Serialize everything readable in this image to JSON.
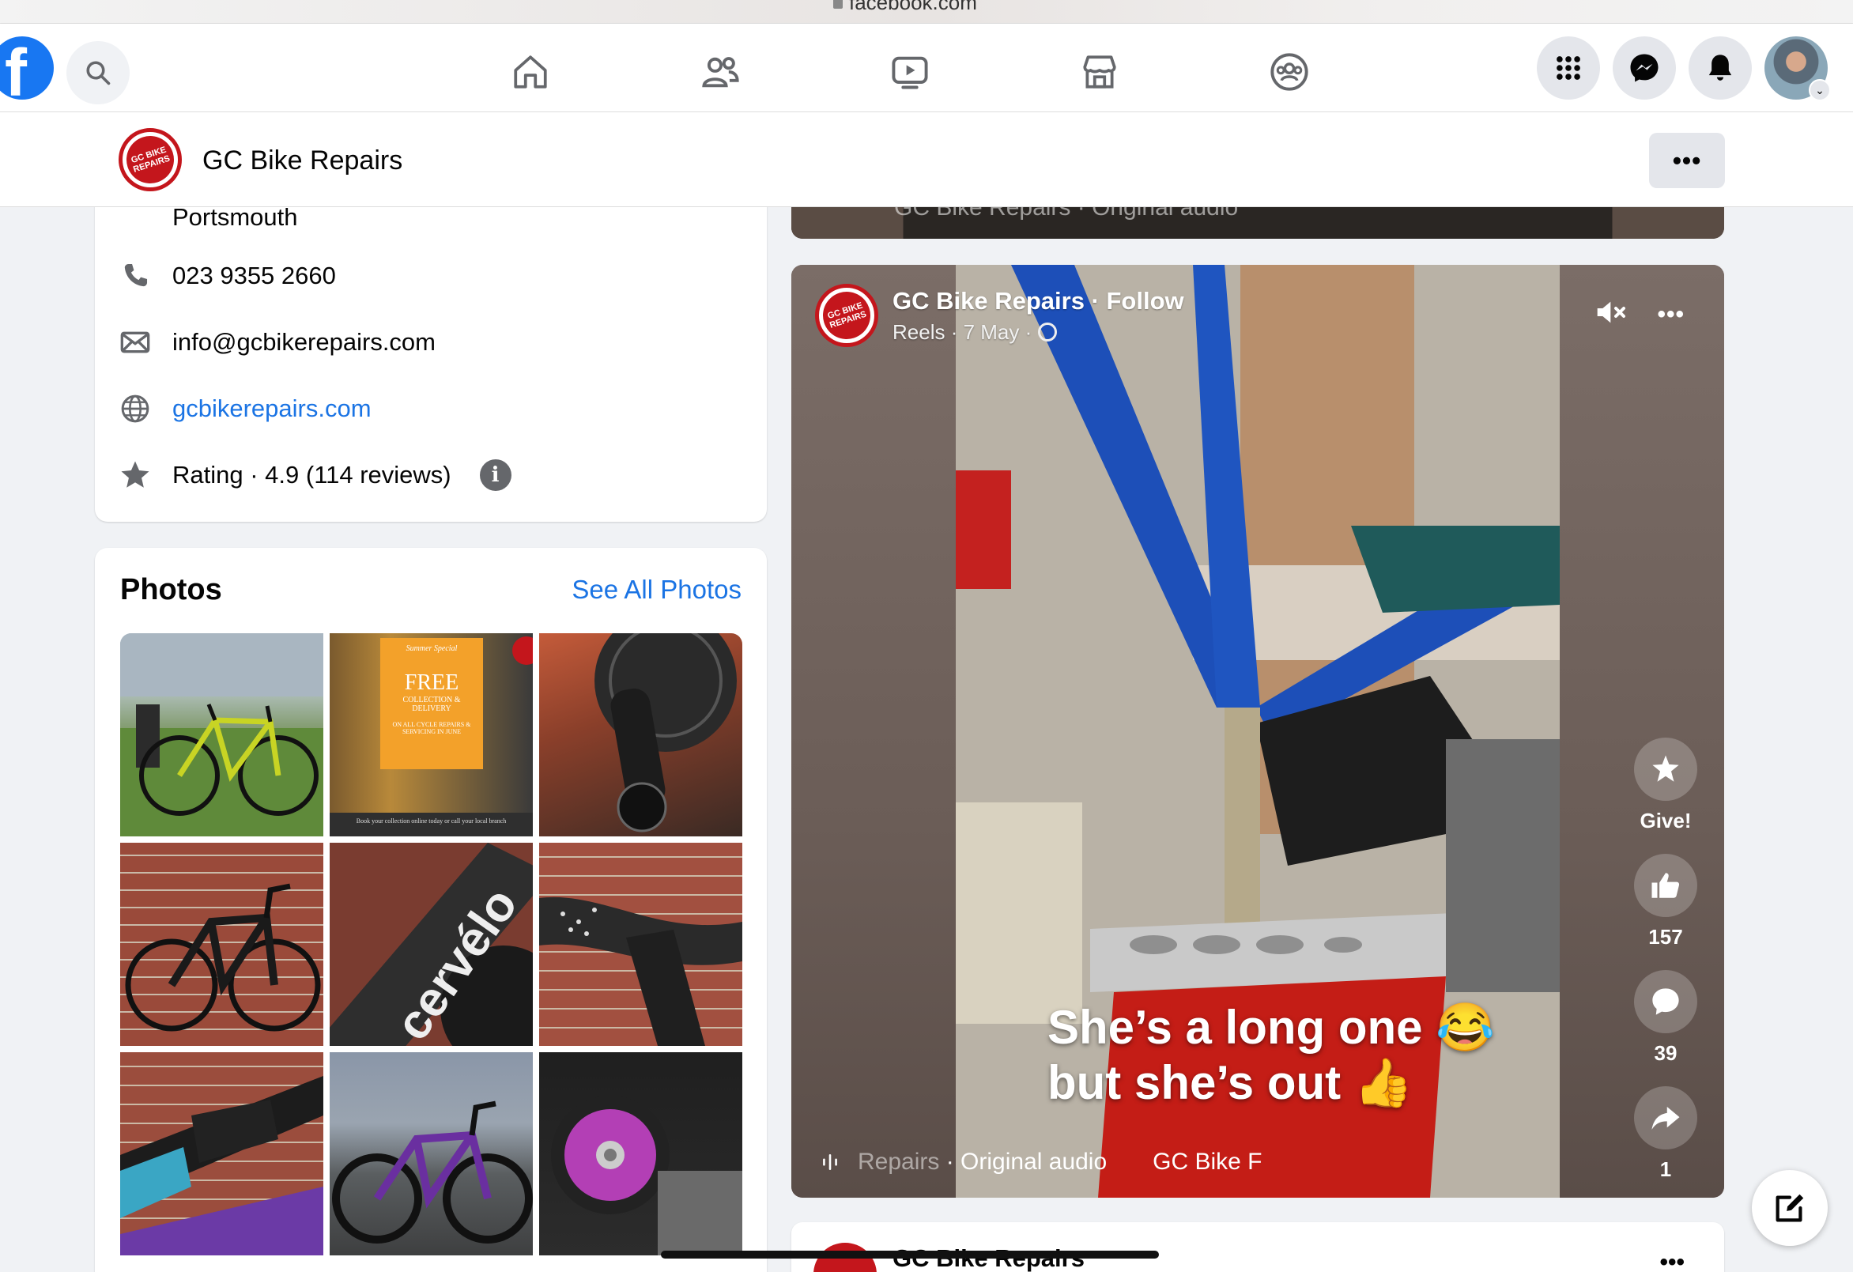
{
  "browser": {
    "url": "facebook.com"
  },
  "topnav": {
    "logo": "f",
    "icons": [
      "search-icon",
      "home-icon",
      "friends-icon",
      "watch-icon",
      "marketplace-icon",
      "groups-icon",
      "menu-grid-icon",
      "messenger-icon",
      "notifications-icon"
    ]
  },
  "page_header": {
    "name": "GC Bike Repairs",
    "logo_text": "GC BIKE REPAIRS",
    "more_label": "•••"
  },
  "intro": {
    "location": "Portsmouth",
    "phone": "023 9355 2660",
    "email": "info@gcbikerepairs.com",
    "website": "gcbikerepairs.com",
    "rating": "Rating · 4.9 (114 reviews)"
  },
  "photos": {
    "title": "Photos",
    "see_all": "See All Photos",
    "poster": {
      "heading": "Summer Special",
      "free": "FREE",
      "service": "COLLECTION & DELIVERY",
      "offer": "ON ALL CYCLE REPAIRS & SERVICING IN JUNE",
      "footer": "Book your collection online today or call your local branch"
    }
  },
  "prev_reel": {
    "audio": "GC Bike Repairs · Original audio"
  },
  "reel": {
    "author": "GC Bike Repairs · Follow",
    "meta": "Reels · 7 May ·",
    "caption_line1": "She’s a long one 😂",
    "caption_line2": "but she’s out 👍",
    "audio_faded": "Repairs",
    "audio": "· Original audio",
    "audio_next": "GC Bike F",
    "actions": {
      "give_label": "Give!",
      "likes": "157",
      "comments": "39",
      "shares": "1"
    },
    "more_label": "•••"
  },
  "next_post": {
    "author": "GC Bike Repairs",
    "more_label": "•••"
  }
}
